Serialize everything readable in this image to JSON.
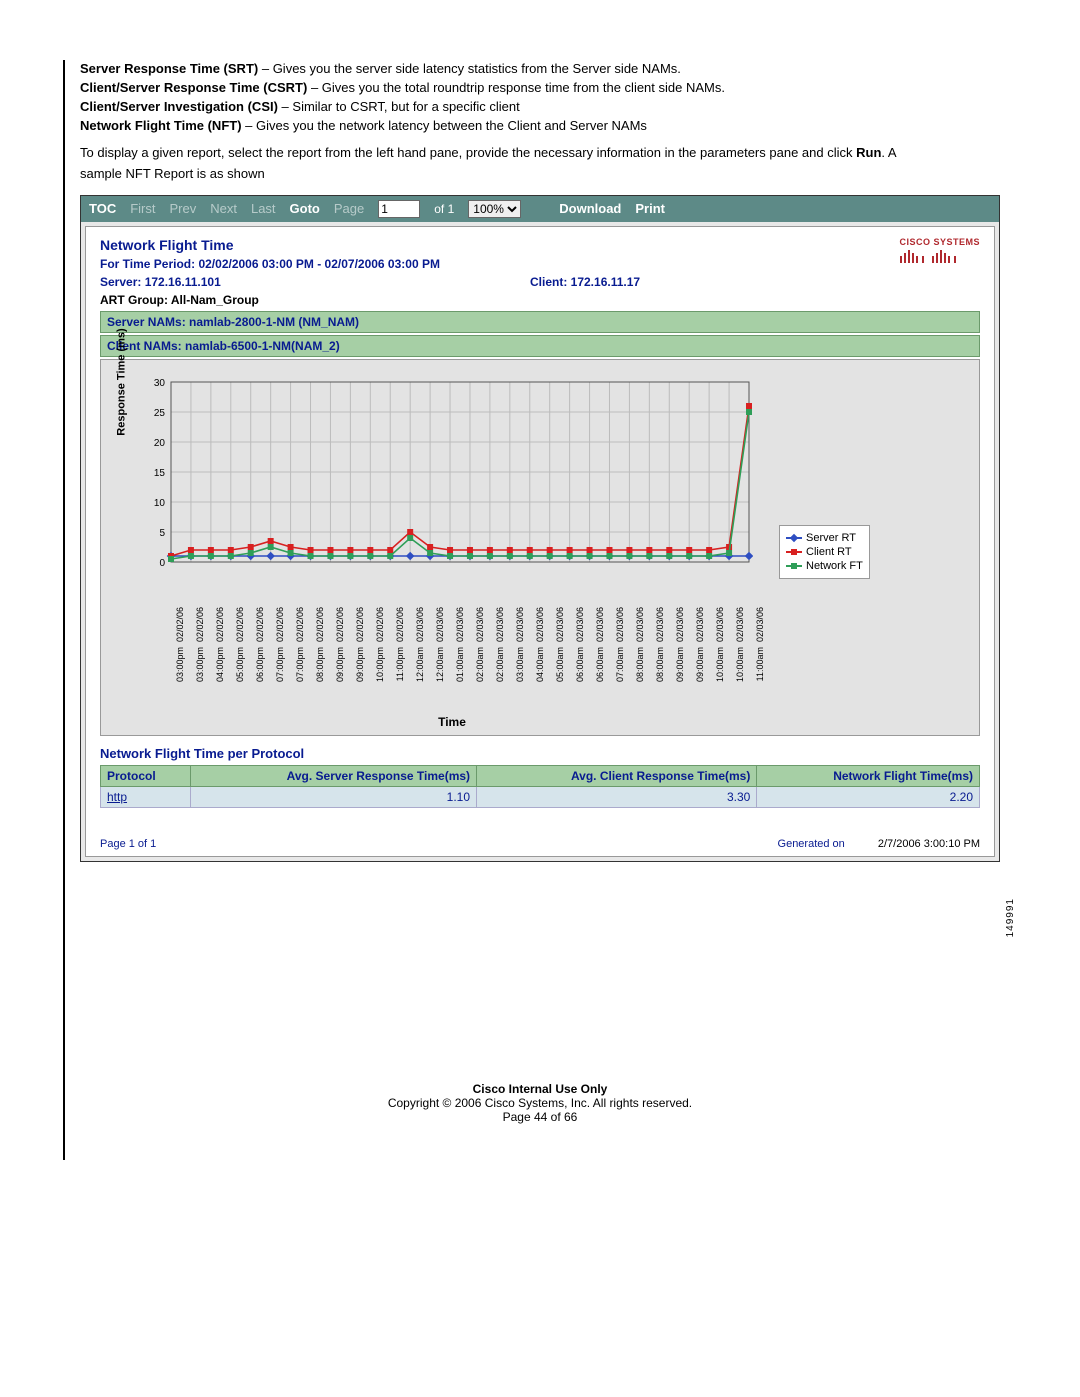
{
  "definitions": [
    {
      "term": "Server Response Time (SRT)",
      "dash": " – ",
      "text": "Gives you the server side latency statistics from the Server side NAMs."
    },
    {
      "term": "Client/Server Response Time (CSRT)",
      "dash": " – ",
      "text": "Gives you the total roundtrip response time from the client side NAMs."
    },
    {
      "term": "Client/Server Investigation (CSI)",
      "dash": " – ",
      "text": "Similar to CSRT, but for a specific client"
    },
    {
      "term": "Network Flight Time (NFT)",
      "dash": " – ",
      "text": "Gives you the network latency between the Client and Server NAMs"
    }
  ],
  "intro": {
    "line1_pre": "To display a given report, select the report from the left hand pane, provide the necessary information in the parameters pane and click ",
    "run": "Run",
    "line1_post": ". A",
    "line2": "sample NFT Report is as shown"
  },
  "toolbar": {
    "toc": "TOC",
    "first": "First",
    "prev": "Prev",
    "next": "Next",
    "last": "Last",
    "goto": "Goto",
    "page": "Page",
    "page_value": "1",
    "of": "of 1",
    "zoom": "100%",
    "download": "Download",
    "print": "Print"
  },
  "header": {
    "title": "Network Flight Time",
    "period": "For Time Period: 02/02/2006 03:00 PM - 02/07/2006 03:00 PM",
    "server": "Server: 172.16.11.101",
    "client": "Client: 172.16.11.17",
    "art": "ART Group: All-Nam_Group",
    "server_nams": "Server NAMs: namlab-2800-1-NM (NM_NAM)",
    "client_nams": "Client NAMs: namlab-6500-1-NM(NAM_2)",
    "cisco": "CISCO SYSTEMS"
  },
  "chart_data": {
    "type": "line",
    "xlabel": "Time",
    "ylabel": "Response Time (ms)",
    "ylim": [
      0,
      30
    ],
    "yticks": [
      0,
      5,
      10,
      15,
      20,
      25,
      30
    ],
    "categories": [
      {
        "date": "02/02/06",
        "time": "03:00pm"
      },
      {
        "date": "02/02/06",
        "time": "03:00pm"
      },
      {
        "date": "02/02/06",
        "time": "04:00pm"
      },
      {
        "date": "02/02/06",
        "time": "05:00pm"
      },
      {
        "date": "02/02/06",
        "time": "06:00pm"
      },
      {
        "date": "02/02/06",
        "time": "07:00pm"
      },
      {
        "date": "02/02/06",
        "time": "07:00pm"
      },
      {
        "date": "02/02/06",
        "time": "08:00pm"
      },
      {
        "date": "02/02/06",
        "time": "09:00pm"
      },
      {
        "date": "02/02/06",
        "time": "09:00pm"
      },
      {
        "date": "02/02/06",
        "time": "10:00pm"
      },
      {
        "date": "02/02/06",
        "time": "11:00pm"
      },
      {
        "date": "02/03/06",
        "time": "12:00am"
      },
      {
        "date": "02/03/06",
        "time": "12:00am"
      },
      {
        "date": "02/03/06",
        "time": "01:00am"
      },
      {
        "date": "02/03/06",
        "time": "02:00am"
      },
      {
        "date": "02/03/06",
        "time": "02:00am"
      },
      {
        "date": "02/03/06",
        "time": "03:00am"
      },
      {
        "date": "02/03/06",
        "time": "04:00am"
      },
      {
        "date": "02/03/06",
        "time": "05:00am"
      },
      {
        "date": "02/03/06",
        "time": "06:00am"
      },
      {
        "date": "02/03/06",
        "time": "06:00am"
      },
      {
        "date": "02/03/06",
        "time": "07:00am"
      },
      {
        "date": "02/03/06",
        "time": "08:00am"
      },
      {
        "date": "02/03/06",
        "time": "08:00am"
      },
      {
        "date": "02/03/06",
        "time": "09:00am"
      },
      {
        "date": "02/03/06",
        "time": "09:00am"
      },
      {
        "date": "02/03/06",
        "time": "10:00am"
      },
      {
        "date": "02/03/06",
        "time": "10:00am"
      },
      {
        "date": "02/03/06",
        "time": "11:00am"
      }
    ],
    "series": [
      {
        "name": "Server RT",
        "color": "#2e4ec2",
        "values": [
          1,
          1,
          1,
          1,
          1,
          1,
          1,
          1,
          1,
          1,
          1,
          1,
          1,
          1,
          1,
          1,
          1,
          1,
          1,
          1,
          1,
          1,
          1,
          1,
          1,
          1,
          1,
          1,
          1,
          1
        ]
      },
      {
        "name": "Client RT",
        "color": "#d82020",
        "values": [
          1,
          2,
          2,
          2,
          2.5,
          3.5,
          2.5,
          2,
          2,
          2,
          2,
          2,
          5,
          2.5,
          2,
          2,
          2,
          2,
          2,
          2,
          2,
          2,
          2,
          2,
          2,
          2,
          2,
          2,
          2.5,
          26
        ]
      },
      {
        "name": "Network FT",
        "color": "#2f9e58",
        "values": [
          0.5,
          1,
          1,
          1,
          1.5,
          2.5,
          1.5,
          1,
          1,
          1,
          1,
          1,
          4,
          1.5,
          1,
          1,
          1,
          1,
          1,
          1,
          1,
          1,
          1,
          1,
          1,
          1,
          1,
          1,
          1.5,
          25
        ]
      }
    ],
    "legend": [
      "Server RT",
      "Client RT",
      "Network FT"
    ]
  },
  "protocol_section": {
    "title": "Network Flight Time per Protocol",
    "headers": [
      "Protocol",
      "Avg. Server Response Time(ms)",
      "Avg. Client Response Time(ms)",
      "Network Flight Time(ms)"
    ],
    "rows": [
      {
        "protocol": "http",
        "srv": "1.10",
        "cli": "3.30",
        "nft": "2.20"
      }
    ]
  },
  "report_footer": {
    "page": "Page 1 of 1",
    "gen_label": "Generated on",
    "gen_date": "2/7/2006 3:00:10 PM"
  },
  "side_code": "149991",
  "footer": {
    "bold": "Cisco Internal Use Only",
    "copy": "Copyright © 2006 Cisco Systems, Inc. All rights reserved.",
    "page": "Page 44 of 66"
  }
}
